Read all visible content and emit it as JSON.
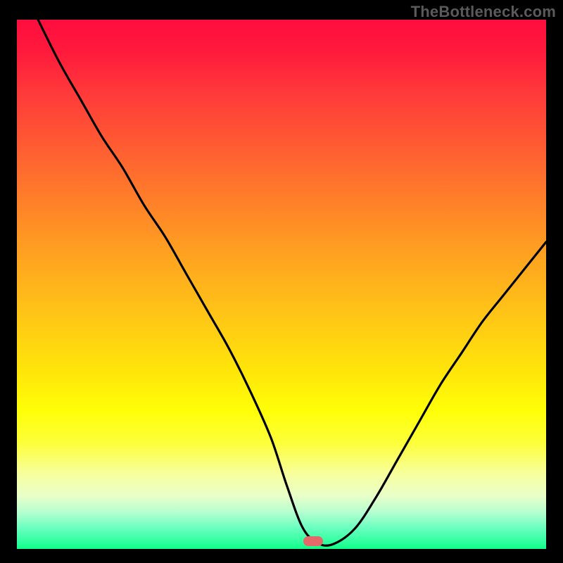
{
  "watermark_text": "TheBottleneck.com",
  "chart_data": {
    "type": "line",
    "title": "",
    "xlabel": "",
    "ylabel": "",
    "xlim": [
      0,
      100
    ],
    "ylim": [
      0,
      100
    ],
    "grid": false,
    "legend": null,
    "background_gradient": {
      "top_color": "#ff0d3f",
      "bottom_color": "#10ff88",
      "stops": [
        {
          "pct": 0,
          "color": "#ff0d3f"
        },
        {
          "pct": 14,
          "color": "#ff3a3a"
        },
        {
          "pct": 42,
          "color": "#ff9a22"
        },
        {
          "pct": 66,
          "color": "#ffe40a"
        },
        {
          "pct": 86,
          "color": "#f7ffa0"
        },
        {
          "pct": 100,
          "color": "#10ff88"
        }
      ]
    },
    "series": [
      {
        "name": "bottleneck-curve",
        "color": "#000000",
        "x": [
          4,
          8,
          12,
          16,
          20,
          24,
          28,
          32,
          36,
          40,
          44,
          48,
          51,
          54,
          57,
          60,
          64,
          68,
          72,
          76,
          80,
          84,
          88,
          92,
          96,
          100
        ],
        "y": [
          100,
          92,
          85,
          78,
          72,
          65,
          59,
          52,
          45,
          38,
          30,
          21,
          12,
          4,
          1,
          1,
          4,
          10,
          17,
          24,
          31,
          37,
          43,
          48,
          53,
          58
        ]
      }
    ],
    "marker": {
      "name": "optimal-flat-region",
      "x_center": 56,
      "y": 1.5,
      "color": "#e46a6a"
    }
  }
}
